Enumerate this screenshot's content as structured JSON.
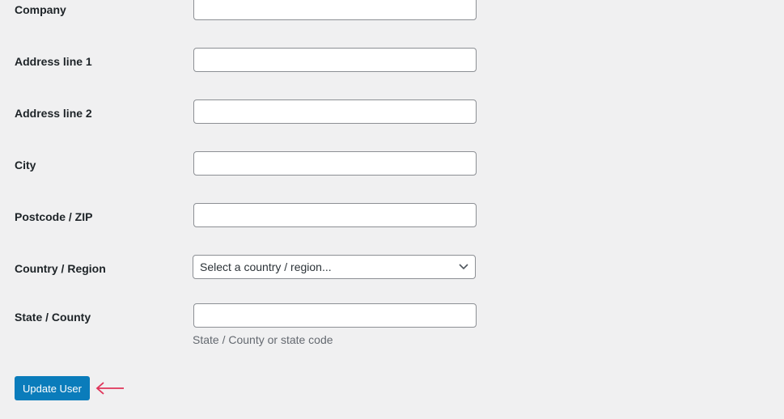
{
  "fields": [
    {
      "label": "Company",
      "value": ""
    },
    {
      "label": "Address line 1",
      "value": ""
    },
    {
      "label": "Address line 2",
      "value": ""
    },
    {
      "label": "City",
      "value": ""
    },
    {
      "label": "Postcode / ZIP",
      "value": ""
    }
  ],
  "country": {
    "label": "Country / Region",
    "selected": "Select a country / region..."
  },
  "state": {
    "label": "State / County",
    "value": "",
    "description": "State / County or state code"
  },
  "update_button": "Update User",
  "colors": {
    "button": "#0a7cbb",
    "arrow": "#e0345a",
    "background": "#f0f0f1"
  }
}
